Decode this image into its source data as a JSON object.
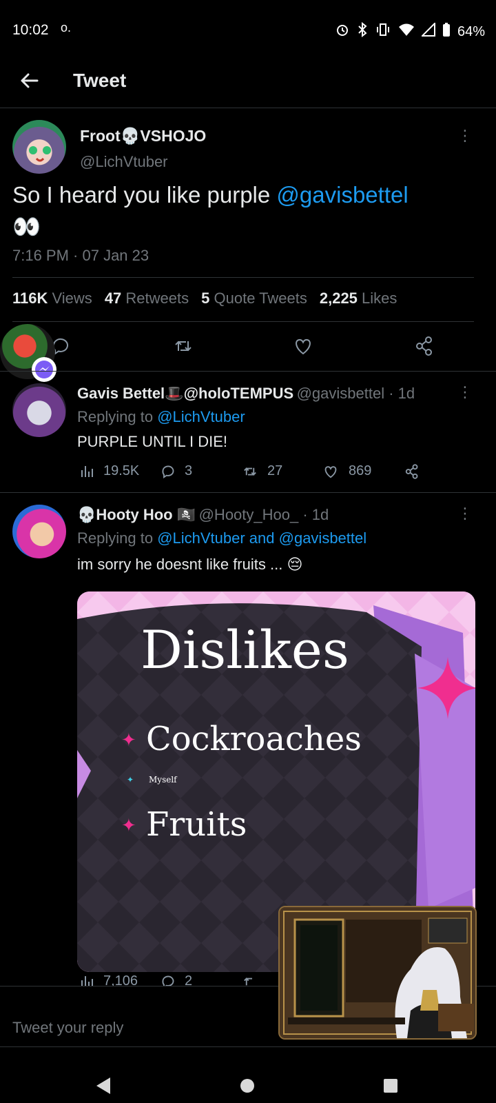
{
  "status_bar": {
    "time": "10:02",
    "notif_icon": "o.",
    "battery": "64%",
    "icons": [
      "alarm-icon",
      "bluetooth-icon",
      "vibrate-icon",
      "wifi-icon",
      "signal-icon",
      "battery-icon"
    ]
  },
  "header": {
    "title": "Tweet"
  },
  "main_tweet": {
    "display_name": "Froot",
    "name_emoji": "💀",
    "name_suffix": "VSHOJO",
    "handle": "@LichVtuber",
    "text": "So I heard you like purple ",
    "mention": "@gavisbettel",
    "emoji": "👀",
    "timestamp": "7:16 PM · 07 Jan 23",
    "stats": {
      "views_count": "116K",
      "views_label": "Views",
      "retweets_count": "47",
      "retweets_label": "Retweets",
      "quotes_count": "5",
      "quotes_label": "Quote Tweets",
      "likes_count": "2,225",
      "likes_label": "Likes"
    }
  },
  "reply1": {
    "display_name": "Gavis Bettel",
    "name_emoji": "🎩",
    "name_suffix": "@holoTEMPUS",
    "handle_meta": "@gavisbettel · 1d",
    "replying_prefix": "Replying to ",
    "replying_to": "@LichVtuber",
    "text": "PURPLE UNTIL I DIE!",
    "views": "19.5K",
    "replies": "3",
    "retweets": "27",
    "likes": "869"
  },
  "reply2": {
    "name_prefix_emoji": "💀",
    "display_name": "Hooty Hoo",
    "name_emoji": "🏴‍☠️",
    "handle_meta": "@Hooty_Hoo_ · 1d",
    "replying_prefix": "Replying to ",
    "replying_to": "@LichVtuber and @gavisbettel",
    "text": "im sorry he doesnt like fruits ... ",
    "text_emoji": "😔",
    "image": {
      "title": "Dislikes",
      "items": [
        "Cockroaches",
        "Myself",
        "Fruits"
      ]
    },
    "views": "7,106",
    "replies": "2"
  },
  "reply_box": {
    "placeholder": "Tweet your reply"
  },
  "colors": {
    "accent": "#1d9bf0",
    "background": "#000000",
    "muted": "#71767b",
    "divider": "#2f3336"
  }
}
